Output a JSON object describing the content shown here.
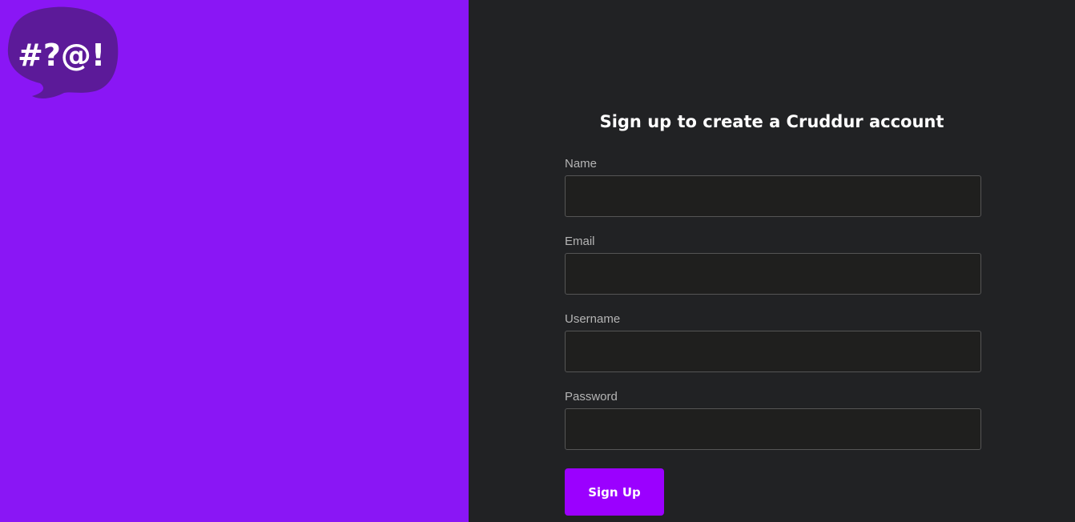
{
  "brand": {
    "logo_text": "#?@!",
    "colors": {
      "panel": "#8a16f5",
      "bubble": "#5c1a99",
      "logo_text": "#ffffff"
    }
  },
  "signup_form": {
    "title": "Sign up to create a Cruddur account",
    "fields": [
      {
        "label": "Name",
        "value": "",
        "type": "text"
      },
      {
        "label": "Email",
        "value": "",
        "type": "email"
      },
      {
        "label": "Username",
        "value": "",
        "type": "text"
      },
      {
        "label": "Password",
        "value": "",
        "type": "password"
      }
    ],
    "submit_label": "Sign Up",
    "colors": {
      "panel": "#212224",
      "input_bg": "#1f1f1e",
      "input_border": "#555555",
      "label": "#b5b5b5",
      "button": "#9b00ff"
    }
  }
}
